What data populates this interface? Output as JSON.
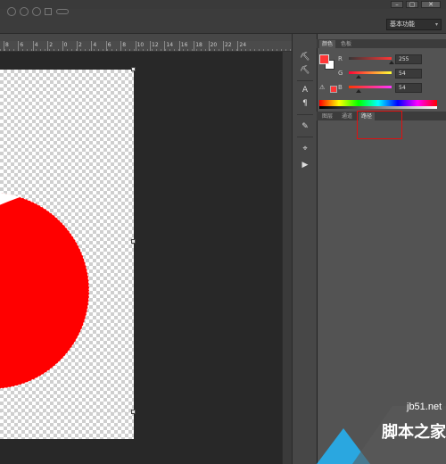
{
  "window": {
    "minimize": "–",
    "restore": "▢",
    "close": "✕"
  },
  "options_bar": {
    "workspace": "基本功能",
    "workspace_arrow": "▾"
  },
  "ruler": {
    "numbers": [
      "8",
      "6",
      "4",
      "2",
      "0",
      "2",
      "4",
      "6",
      "8",
      "10",
      "12",
      "14",
      "16",
      "18",
      "20",
      "22",
      "24"
    ]
  },
  "tools": {
    "tool1": "⛏",
    "tool2": "⛏",
    "tool3": "A",
    "tool4": "¶",
    "tool5": "✎",
    "tool6": "⌖",
    "tool7": "▶"
  },
  "color_panel": {
    "tabs": [
      "颜色",
      "色板"
    ],
    "channels": [
      {
        "label": "R",
        "value": "255"
      },
      {
        "label": "G",
        "value": "54"
      },
      {
        "label": "B",
        "value": "54"
      }
    ],
    "foreground": "#ff3636",
    "background": "#ffffff"
  },
  "layers_panel": {
    "tabs": [
      "图层",
      "通道",
      "路径"
    ],
    "active_tab": "路径"
  },
  "watermark": {
    "url": "jb51.net",
    "text": "脚本之家"
  },
  "colors": {
    "logo_red": "#ff0000",
    "highlight": "#e01010"
  }
}
